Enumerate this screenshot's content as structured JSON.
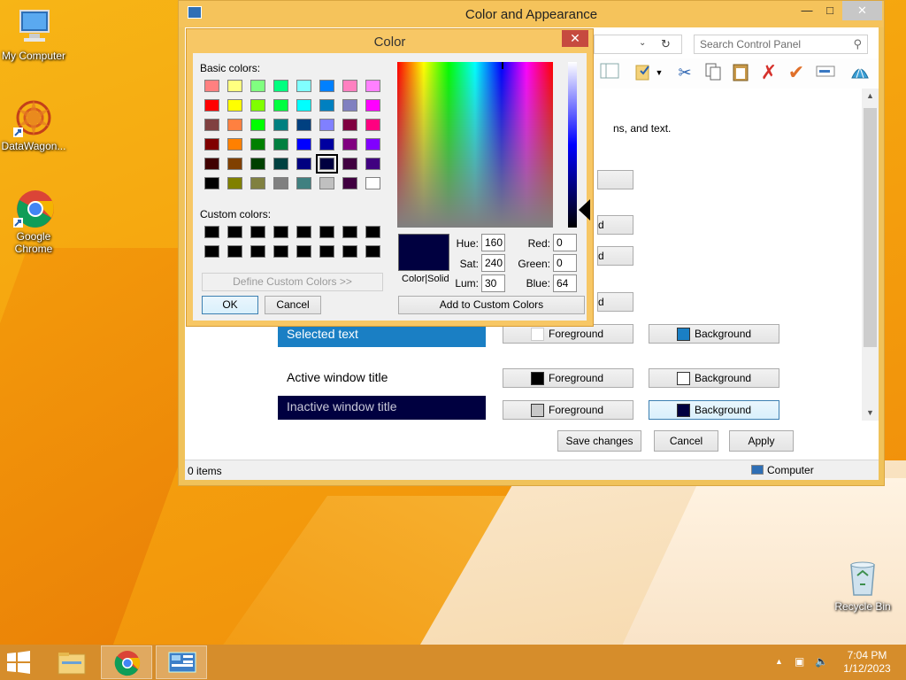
{
  "desktop": {
    "icons": [
      {
        "label": "My Computer"
      },
      {
        "label": "DataWagon..."
      },
      {
        "label": "Google Chrome"
      },
      {
        "label": "Recycle Bin"
      }
    ]
  },
  "window": {
    "title": "Color and Appearance",
    "search_placeholder": "Search Control Panel",
    "description_partial": "ns, and text.",
    "samples": {
      "selected_text": "Selected text",
      "active_title": "Active window title",
      "inactive_title": "Inactive window title"
    },
    "rows": [
      {
        "foreground_label": "Foreground",
        "background_label": "Background",
        "fg_color": "#ffffff",
        "bg_color": "#1a7fc4"
      },
      {
        "foreground_label": "Foreground",
        "background_label": "Background",
        "fg_color": "#000000",
        "bg_color": "#ffffff"
      },
      {
        "foreground_label": "Foreground",
        "background_label": "Background",
        "fg_color": "#c8c8c8",
        "bg_color": "#000040"
      }
    ],
    "partial_buttons": [
      "d",
      "d",
      "d"
    ],
    "buttons": {
      "save": "Save changes",
      "cancel": "Cancel",
      "apply": "Apply"
    },
    "status": {
      "items": "0 items",
      "location": "Computer"
    }
  },
  "color_dialog": {
    "title": "Color",
    "basic_colors_label": "Basic colors:",
    "custom_colors_label": "Custom colors:",
    "define_custom": "Define Custom Colors >>",
    "ok": "OK",
    "cancel": "Cancel",
    "add_to_custom": "Add to Custom Colors",
    "color_solid_label": "Color|Solid",
    "fields": {
      "hue_label": "Hue:",
      "hue": "160",
      "sat_label": "Sat:",
      "sat": "240",
      "lum_label": "Lum:",
      "lum": "30",
      "red_label": "Red:",
      "red": "0",
      "green_label": "Green:",
      "green": "0",
      "blue_label": "Blue:",
      "blue": "64"
    },
    "basic_colors": [
      [
        "#ff8080",
        "#ffff80",
        "#80ff80",
        "#00ff80",
        "#80ffff",
        "#0080ff",
        "#ff80c0",
        "#ff80ff"
      ],
      [
        "#ff0000",
        "#ffff00",
        "#80ff00",
        "#00ff40",
        "#00ffff",
        "#0080c0",
        "#8080c0",
        "#ff00ff"
      ],
      [
        "#804040",
        "#ff8040",
        "#00ff00",
        "#008080",
        "#004080",
        "#8080ff",
        "#800040",
        "#ff0080"
      ],
      [
        "#800000",
        "#ff8000",
        "#008000",
        "#008040",
        "#0000ff",
        "#0000a0",
        "#800080",
        "#8000ff"
      ],
      [
        "#400000",
        "#804000",
        "#004000",
        "#004040",
        "#000080",
        "#000040",
        "#400040",
        "#400080"
      ],
      [
        "#000000",
        "#808000",
        "#808040",
        "#808080",
        "#408080",
        "#c0c0c0",
        "#400040",
        "#ffffff"
      ]
    ],
    "selected_basic": [
      4,
      5
    ],
    "preview_color": "#000040"
  },
  "taskbar": {
    "time": "7:04 PM",
    "date": "1/12/2023"
  }
}
